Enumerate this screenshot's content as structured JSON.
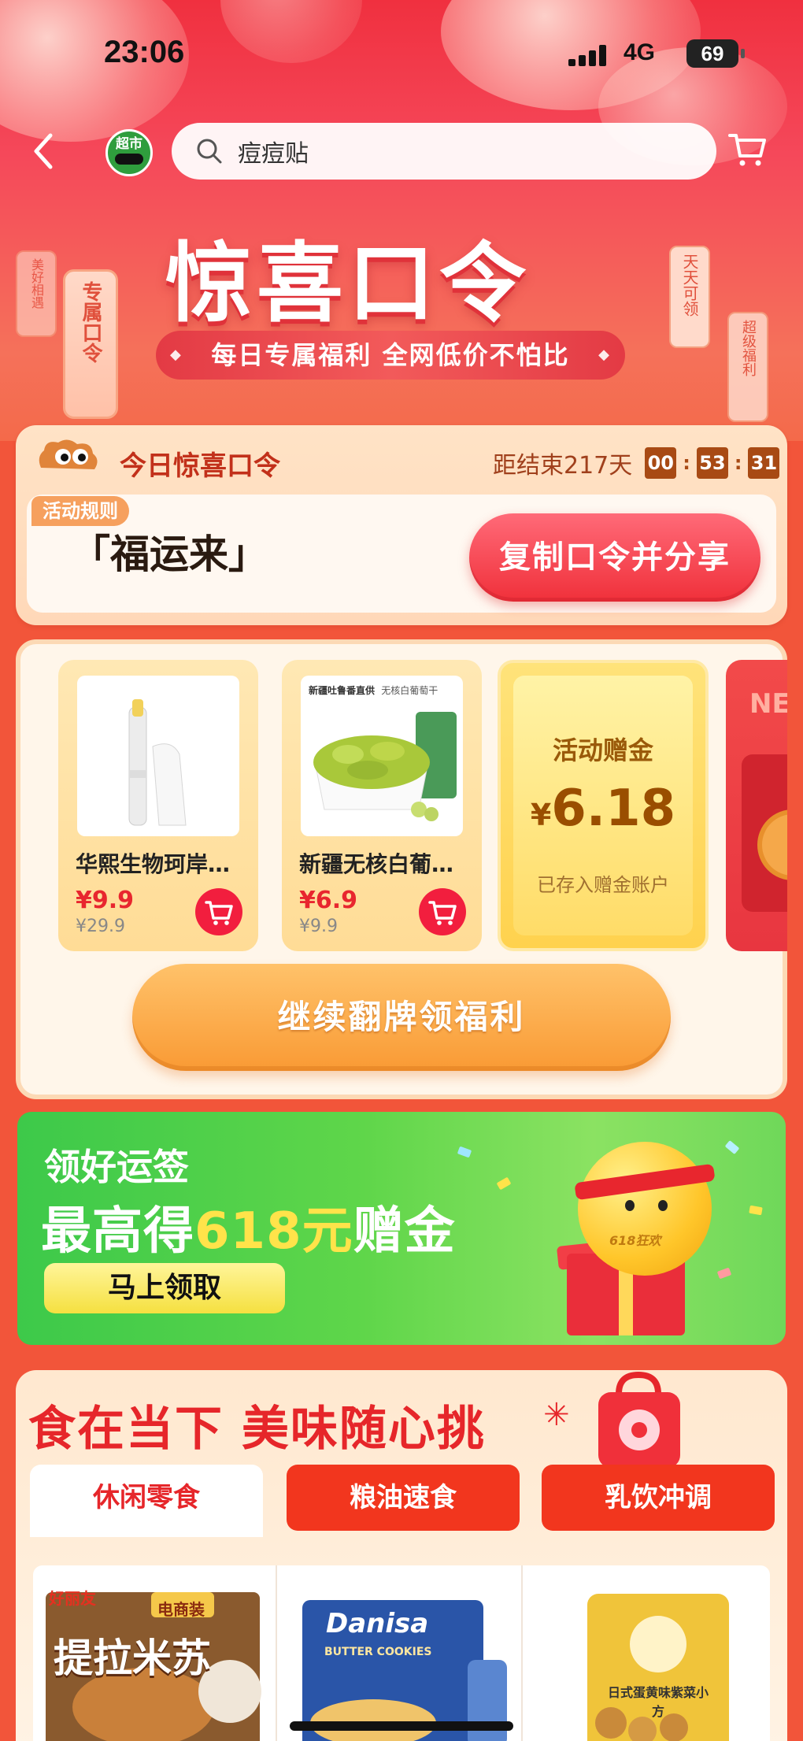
{
  "status_bar": {
    "time": "23:06",
    "network": "4G",
    "battery": "69"
  },
  "header": {
    "logo_label": "超市",
    "search_placeholder": "痘痘贴"
  },
  "hero": {
    "title": "惊喜口令",
    "subtitle": "每日专属福利 全网低价不怕比",
    "left_tag": "专属口令",
    "right_tag": "天天可领",
    "right_tag_2": "超级福利",
    "left_tag_small": "美好相遇"
  },
  "password_card": {
    "title": "今日惊喜口令",
    "countdown_label": "距结束217天",
    "countdown": [
      "00",
      "53",
      "31"
    ],
    "rule_label": "活动规则",
    "code": "「福运来」",
    "copy_button": "复制口令并分享"
  },
  "products": [
    {
      "name": "华熙生物珂岸…",
      "price": "¥9.9",
      "original_price": "¥29.9"
    },
    {
      "name": "新疆无核白葡…",
      "price": "¥6.9",
      "original_price": "¥9.9",
      "img_caption": "新疆吐鲁番直供",
      "img_caption_2": "无核白葡萄干"
    }
  ],
  "gift": {
    "label": "活动赠金",
    "currency": "¥",
    "amount": "6.18",
    "note": "已存入赠金账户"
  },
  "next_card_text": "NE",
  "flip_button": "继续翻牌领福利",
  "banner": {
    "line1": "领好运签",
    "line2_prefix": "最高得",
    "line2_highlight": "618元",
    "line2_suffix": "赠金",
    "button": "马上领取",
    "ball_label": "618狂欢"
  },
  "food_section": {
    "title": "食在当下 美味随心挑",
    "tabs": [
      {
        "label": "休闲零食",
        "active": true
      },
      {
        "label": "粮油速食",
        "active": false
      },
      {
        "label": "乳饮冲调",
        "active": false
      }
    ],
    "items": [
      {
        "brand": "好丽友",
        "name": "提拉米苏",
        "tag": "电商装"
      },
      {
        "brand": "Danisa",
        "sub": "BUTTER COOKIES"
      },
      {
        "name": "日式蛋黄味紫菜小方"
      }
    ]
  }
}
